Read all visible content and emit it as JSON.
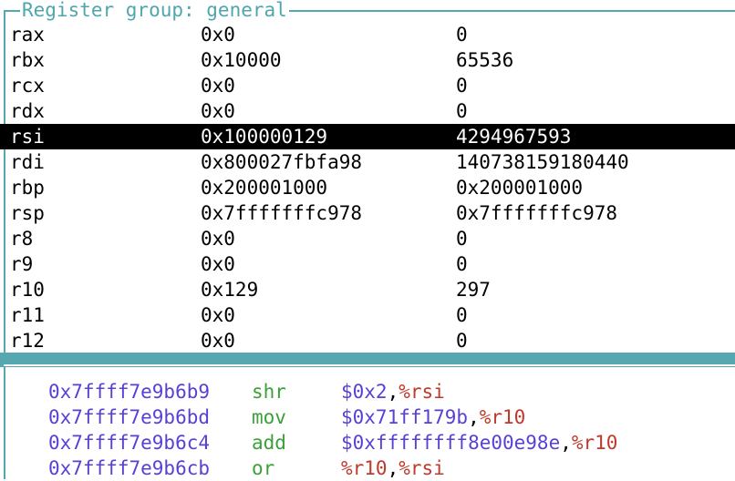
{
  "register_window": {
    "title": "Register group: general",
    "registers": [
      {
        "name": "rax",
        "hex": "0x0",
        "natural": "0"
      },
      {
        "name": "rbx",
        "hex": "0x10000",
        "natural": "65536"
      },
      {
        "name": "rcx",
        "hex": "0x0",
        "natural": "0"
      },
      {
        "name": "rdx",
        "hex": "0x0",
        "natural": "0"
      },
      {
        "name": "rsi",
        "hex": "0x100000129",
        "natural": "4294967593",
        "selected": true
      },
      {
        "name": "rdi",
        "hex": "0x800027fbfa98",
        "natural": "140738159180440"
      },
      {
        "name": "rbp",
        "hex": "0x200001000",
        "natural": "0x200001000"
      },
      {
        "name": "rsp",
        "hex": "0x7fffffffc978",
        "natural": "0x7fffffffc978"
      },
      {
        "name": "r8",
        "hex": "0x0",
        "natural": "0"
      },
      {
        "name": "r9",
        "hex": "0x0",
        "natural": "0"
      },
      {
        "name": "r10",
        "hex": "0x129",
        "natural": "297"
      },
      {
        "name": "r11",
        "hex": "0x0",
        "natural": "0"
      },
      {
        "name": "r12",
        "hex": "0x0",
        "natural": "0"
      }
    ]
  },
  "asm_window": {
    "instructions": [
      {
        "address": "0x7ffff7e9b6b9",
        "mnemonic": "shr",
        "operands": [
          {
            "text": "$0x2",
            "kind": "imm"
          },
          {
            "text": ",",
            "kind": "sep"
          },
          {
            "text": "%rsi",
            "kind": "reg"
          }
        ]
      },
      {
        "address": "0x7ffff7e9b6bd",
        "mnemonic": "mov",
        "operands": [
          {
            "text": "$0x71ff179b",
            "kind": "imm"
          },
          {
            "text": ",",
            "kind": "sep"
          },
          {
            "text": "%r10",
            "kind": "reg"
          }
        ]
      },
      {
        "address": "0x7ffff7e9b6c4",
        "mnemonic": "add",
        "operands": [
          {
            "text": "$0xffffffff8e00e98e",
            "kind": "imm"
          },
          {
            "text": ",",
            "kind": "sep"
          },
          {
            "text": "%r10",
            "kind": "reg"
          }
        ]
      },
      {
        "address": "0x7ffff7e9b6cb",
        "mnemonic": "or",
        "operands": [
          {
            "text": "%r10",
            "kind": "reg"
          },
          {
            "text": ",",
            "kind": "sep"
          },
          {
            "text": "%rsi",
            "kind": "reg"
          }
        ]
      }
    ]
  },
  "colors": {
    "border": "#56a8b0",
    "title": "#4fa7ad",
    "address": "#5a3fd6",
    "mnemonic": "#3aa13a",
    "register": "#c0392b",
    "selection_bg": "#000000",
    "selection_fg": "#ffffff"
  }
}
